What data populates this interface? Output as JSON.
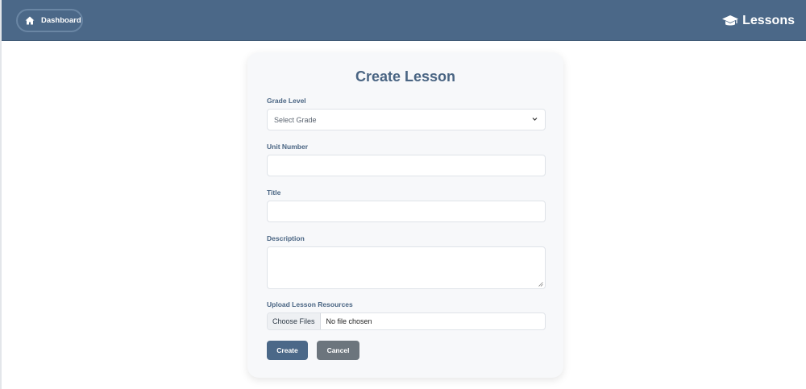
{
  "header": {
    "dashboard_label": "Dashboard",
    "brand_label": "Lessons",
    "home_icon": "home-icon",
    "brand_icon": "graduation-cap-icon",
    "bar_color": "#4b6888"
  },
  "form": {
    "title": "Create Lesson",
    "grade": {
      "label": "Grade Level",
      "selected": "Select Grade"
    },
    "unit": {
      "label": "Unit Number",
      "value": ""
    },
    "title_field": {
      "label": "Title",
      "value": ""
    },
    "description": {
      "label": "Description",
      "value": ""
    },
    "upload": {
      "label": "Upload Lesson Resources",
      "button": "Choose Files",
      "status": "No file chosen"
    },
    "create_label": "Create",
    "cancel_label": "Cancel"
  }
}
